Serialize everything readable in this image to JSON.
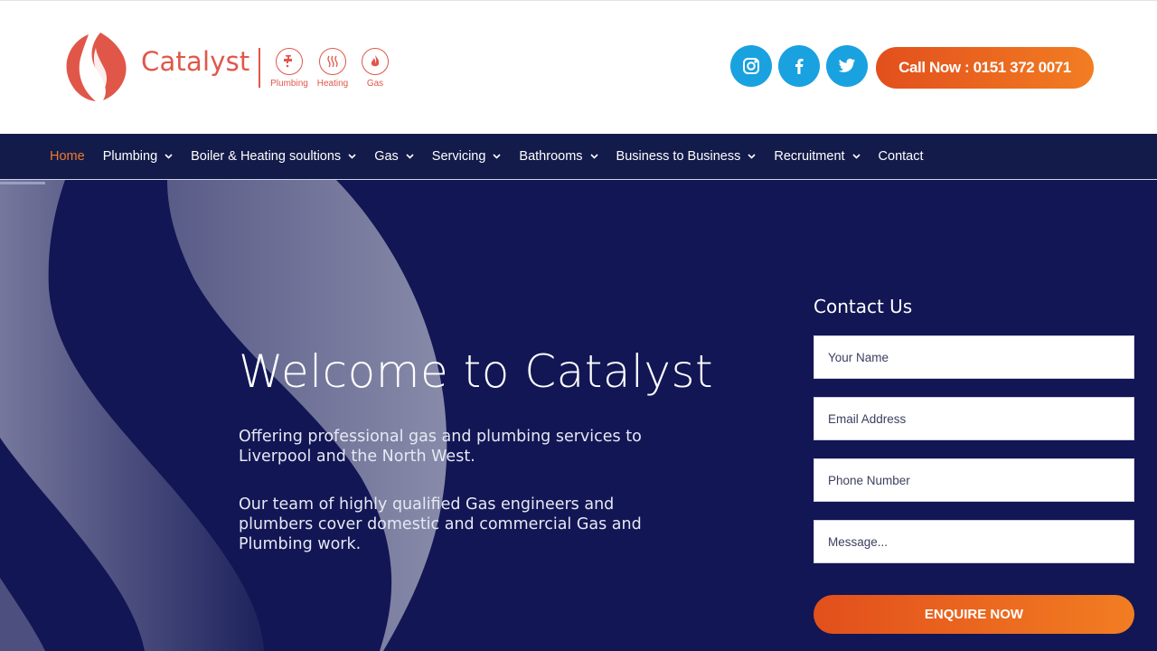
{
  "brand": {
    "name": "Catalyst",
    "services": [
      "Plumbing",
      "Heating",
      "Gas"
    ],
    "color": "#e0574a"
  },
  "header": {
    "social": [
      "instagram-icon",
      "facebook-icon",
      "twitter-icon"
    ],
    "call_label": "Call Now : 0151 372 0071"
  },
  "nav": {
    "items": [
      {
        "label": "Home",
        "active": true,
        "dropdown": false
      },
      {
        "label": "Plumbing",
        "dropdown": true
      },
      {
        "label": "Boiler & Heating soultions",
        "dropdown": true
      },
      {
        "label": "Gas",
        "dropdown": true
      },
      {
        "label": "Servicing",
        "dropdown": true
      },
      {
        "label": "Bathrooms",
        "dropdown": true
      },
      {
        "label": "Business to Business",
        "dropdown": true
      },
      {
        "label": "Recruitment",
        "dropdown": true
      },
      {
        "label": "Contact",
        "dropdown": false
      }
    ]
  },
  "hero": {
    "title": "Welcome to Catalyst",
    "paragraph1": "Offering professional gas and plumbing services to Liverpool and the North West.",
    "paragraph2": "Our team of highly qualified Gas engineers and plumbers cover domestic and commercial Gas and Plumbing work."
  },
  "contact_form": {
    "title": "Contact Us",
    "name_placeholder": "Your Name",
    "email_placeholder": "Email Address",
    "phone_placeholder": "Phone Number",
    "message_placeholder": "Message...",
    "submit_label": "ENQUIRE NOW"
  },
  "colors": {
    "accent_orange": "#f27d22",
    "nav_bg": "#131b4a",
    "hero_bg": "#121654",
    "social_blue": "#1aa1e0"
  }
}
